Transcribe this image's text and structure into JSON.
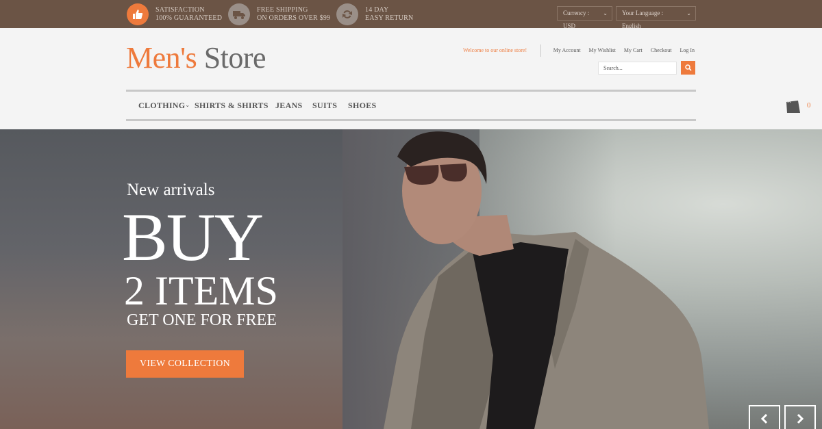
{
  "topbar": {
    "features": [
      {
        "icon": "thumbs-up-icon",
        "line1": "Satisfaction",
        "line2": "100% Guaranteed"
      },
      {
        "icon": "truck-icon",
        "line1": "Free Shipping",
        "line2": "on orders over $99"
      },
      {
        "icon": "refresh-icon",
        "line1": "14 day",
        "line2": "easy return"
      }
    ],
    "currency": "Currency : USD",
    "language": "Your Language : English"
  },
  "header": {
    "logo_brand": "Men's",
    "logo_store": "Store",
    "welcome": "Welcome to our online store!",
    "links": [
      "My Account",
      "My Wishlist",
      "My Cart",
      "Checkout",
      "Log In"
    ],
    "search_placeholder": "Search..."
  },
  "nav": {
    "items": [
      "CLOTHING",
      "SHIRTS & SHIRTS",
      "JEANS",
      "SUITS",
      "SHOES"
    ],
    "cart_count": "0"
  },
  "hero": {
    "small": "New arrivals",
    "big": "BUY",
    "mid": "2 ITEMS",
    "sub": "GET ONE FOR FREE",
    "cta": "VIEW COLLECTION"
  },
  "colors": {
    "accent": "#ee7a3c",
    "topbar": "#6b5445"
  }
}
